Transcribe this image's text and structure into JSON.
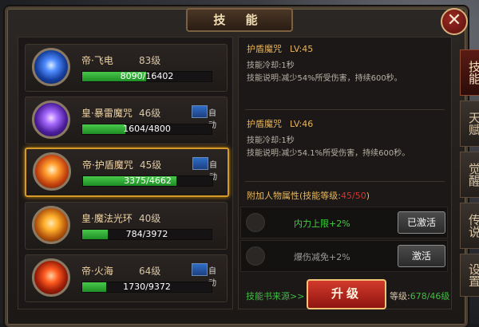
{
  "window": {
    "title": "技 能",
    "close_label": "✕"
  },
  "skills": [
    {
      "name": "帝·飞电",
      "level": "83级",
      "progress": "8090/16402",
      "fraction": 0.493,
      "auto": false,
      "selected": false,
      "orb_color": "#2f6fff"
    },
    {
      "name": "皇·暴雷魔咒",
      "level": "46级",
      "progress": "1604/4800",
      "fraction": 0.334,
      "auto": true,
      "auto_label": "自动",
      "selected": false,
      "orb_color": "#8a4cff"
    },
    {
      "name": "帝·护盾魔咒",
      "level": "45级",
      "progress": "3375/4662",
      "fraction": 0.724,
      "auto": true,
      "auto_label": "自动",
      "selected": true,
      "orb_color": "#ff7a1a"
    },
    {
      "name": "皇·魔法光环",
      "level": "40级",
      "progress": "784/3972",
      "fraction": 0.197,
      "auto": false,
      "selected": false,
      "orb_color": "#ff9a20"
    },
    {
      "name": "帝·火海",
      "level": "64级",
      "progress": "1730/9372",
      "fraction": 0.185,
      "auto": true,
      "auto_label": "自动",
      "selected": false,
      "orb_color": "#ff4a1a"
    }
  ],
  "detail": {
    "current": {
      "name": "护盾魔咒",
      "lv": "LV:45",
      "cooldown": "技能冷却:1秒",
      "desc": "技能说明:减少54%所受伤害，持续600秒。"
    },
    "next": {
      "name": "护盾魔咒",
      "lv": "LV:46",
      "cooldown": "技能冷却:1秒",
      "desc": "技能说明:减少54.1%所受伤害，持续600秒。"
    }
  },
  "attributes": {
    "title": "附加人物属性(技能等级:",
    "progress": "45/50",
    "title_end": ")",
    "rows": [
      {
        "text": "内力上限+2%",
        "button": "已激活",
        "color": "#3fcf3f"
      },
      {
        "text": "爆伤减免+2%",
        "button": "激活",
        "color": "#9a9a9a"
      }
    ]
  },
  "footer": {
    "source_link": "技能书来源>>",
    "upgrade_button": "升级",
    "level_label": "等级:",
    "level_value": "678/46级"
  },
  "side_tabs": [
    {
      "label": "技能",
      "active": true
    },
    {
      "label": "天赋",
      "active": false
    },
    {
      "label": "觉醒",
      "active": false
    },
    {
      "label": "传说",
      "active": false
    },
    {
      "label": "设置",
      "active": false
    }
  ],
  "colors": {
    "accent_gold": "#d69b27",
    "progress_green": "#2fae36",
    "upgrade_red": "#c0281f"
  }
}
